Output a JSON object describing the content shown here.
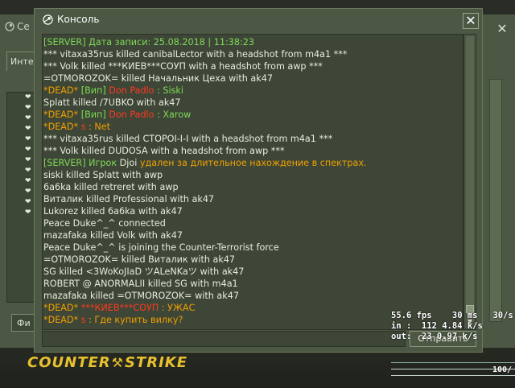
{
  "background": {
    "left_window_title": "Се",
    "left_window_tab": "Инте",
    "left_window_filter": "Фи",
    "right_close": "✕"
  },
  "console": {
    "title": "Консоль",
    "close_label": "✕",
    "lines": [
      [
        {
          "t": "[SERVER] ",
          "c": "green"
        },
        {
          "t": "Дата записи: 25.08.2018 | 11:38:23",
          "c": "green"
        }
      ],
      [
        {
          "t": "*** vitaxa35rus killed canibalLector with a headshot from m4a1 ***",
          "c": "white"
        }
      ],
      [
        {
          "t": "*** Volk killed ***КИЕВ***СОУП with a headshot from awp ***",
          "c": "white"
        }
      ],
      [
        {
          "t": "=OTMOROZOK= killed Начальник Цеха with ak47",
          "c": "white"
        }
      ],
      [
        {
          "t": "*DEAD* ",
          "c": "orange"
        },
        {
          "t": "[Вип] ",
          "c": "green"
        },
        {
          "t": "Don Padlo",
          "c": "red"
        },
        {
          "t": " : Siski",
          "c": "green"
        }
      ],
      [
        {
          "t": "Splatt killed /7UBKO with ak47",
          "c": "white"
        }
      ],
      [
        {
          "t": "*DEAD* ",
          "c": "orange"
        },
        {
          "t": "[Вип] ",
          "c": "green"
        },
        {
          "t": "Don Padlo",
          "c": "red"
        },
        {
          "t": " : Xarow",
          "c": "green"
        }
      ],
      [
        {
          "t": "*DEAD* ",
          "c": "orange"
        },
        {
          "t": "s",
          "c": "red"
        },
        {
          "t": " : Net",
          "c": "orange"
        }
      ],
      [
        {
          "t": "*** vitaxa35rus killed СТОРОI-I-I with a headshot from m4a1 ***",
          "c": "white"
        }
      ],
      [
        {
          "t": "*** Volk killed DUDOSA with a headshot from awp ***",
          "c": "white"
        }
      ],
      [
        {
          "t": "[SERVER] ",
          "c": "green"
        },
        {
          "t": "Игрок ",
          "c": "green"
        },
        {
          "t": "Djoi",
          "c": "white"
        },
        {
          "t": " удален за длительное нахождение в спектрах.",
          "c": "orange"
        }
      ],
      [
        {
          "t": "siski killed Splatt with awp",
          "c": "white"
        }
      ],
      [
        {
          "t": "6a6ka killed retreret with awp",
          "c": "white"
        }
      ],
      [
        {
          "t": "Виталик killed Professional with ak47",
          "c": "white"
        }
      ],
      [
        {
          "t": "Lukorez killed 6a6ka with ak47",
          "c": "white"
        }
      ],
      [
        {
          "t": "Peace Duke^_^ connected",
          "c": "white"
        }
      ],
      [
        {
          "t": "mazafaka killed Volk with ak47",
          "c": "white"
        }
      ],
      [
        {
          "t": "Peace Duke^_^ is joining the Counter-Terrorist force",
          "c": "white"
        }
      ],
      [
        {
          "t": "=OTMOROZOK= killed Виталик with ak47",
          "c": "white"
        }
      ],
      [
        {
          "t": "SG killed <3WoKoJIaD ツALeNKaツ with ak47",
          "c": "white"
        }
      ],
      [
        {
          "t": "ROBERT @ ANORMALII killed SG with m4a1",
          "c": "white"
        }
      ],
      [
        {
          "t": "mazafaka killed =OTMOROZOK= with ak47",
          "c": "white"
        }
      ],
      [
        {
          "t": "*DEAD* ",
          "c": "orange"
        },
        {
          "t": "***КИЕВ***СОУП",
          "c": "red"
        },
        {
          "t": " : УЖАС",
          "c": "orange"
        }
      ],
      [
        {
          "t": "*DEAD* ",
          "c": "orange"
        },
        {
          "t": "s",
          "c": "red"
        },
        {
          "t": " : Где купить вилку?",
          "c": "orange"
        }
      ]
    ],
    "input_value": "",
    "submit_label": "Отправить"
  },
  "hud": {
    "logo_left": "COUNTER",
    "logo_right": "STRIKE",
    "net_fps": "55.6 fps",
    "net_ms": "30 ms",
    "net_rate": "30/s",
    "net_in": "in :  112 4.84 k/s",
    "net_out": "out:  23 0.97 k/s",
    "right_counter": "100/"
  },
  "colors": {
    "green": "#7fd957",
    "orange": "#f0a000",
    "red": "#ff3a20",
    "white": "#e8ecdc",
    "panel": "#4c5844",
    "log_bg": "#3e4637",
    "logo": "#e8c030"
  }
}
